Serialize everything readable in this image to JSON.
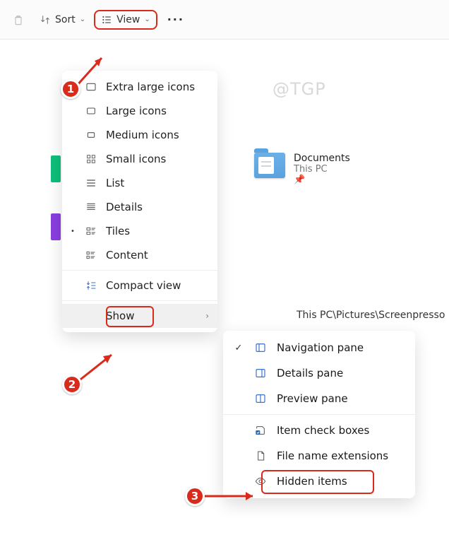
{
  "toolbar": {
    "sort_label": "Sort",
    "view_label": "View"
  },
  "watermark": "@TGP",
  "doc_item": {
    "title": "Documents",
    "subtitle": "This PC"
  },
  "breadcrumb": "This PC\\Pictures\\Screenpresso",
  "view_menu": {
    "items": [
      {
        "label": "Extra large icons"
      },
      {
        "label": "Large icons"
      },
      {
        "label": "Medium icons"
      },
      {
        "label": "Small icons"
      },
      {
        "label": "List"
      },
      {
        "label": "Details"
      },
      {
        "label": "Tiles"
      },
      {
        "label": "Content"
      }
    ],
    "compact": "Compact view",
    "show": "Show"
  },
  "submenu": {
    "items": [
      {
        "label": "Navigation pane"
      },
      {
        "label": "Details pane"
      },
      {
        "label": "Preview pane"
      },
      {
        "label": "Item check boxes"
      },
      {
        "label": "File name extensions"
      },
      {
        "label": "Hidden items"
      }
    ]
  },
  "callouts": {
    "b1": "1",
    "b2": "2",
    "b3": "3"
  }
}
